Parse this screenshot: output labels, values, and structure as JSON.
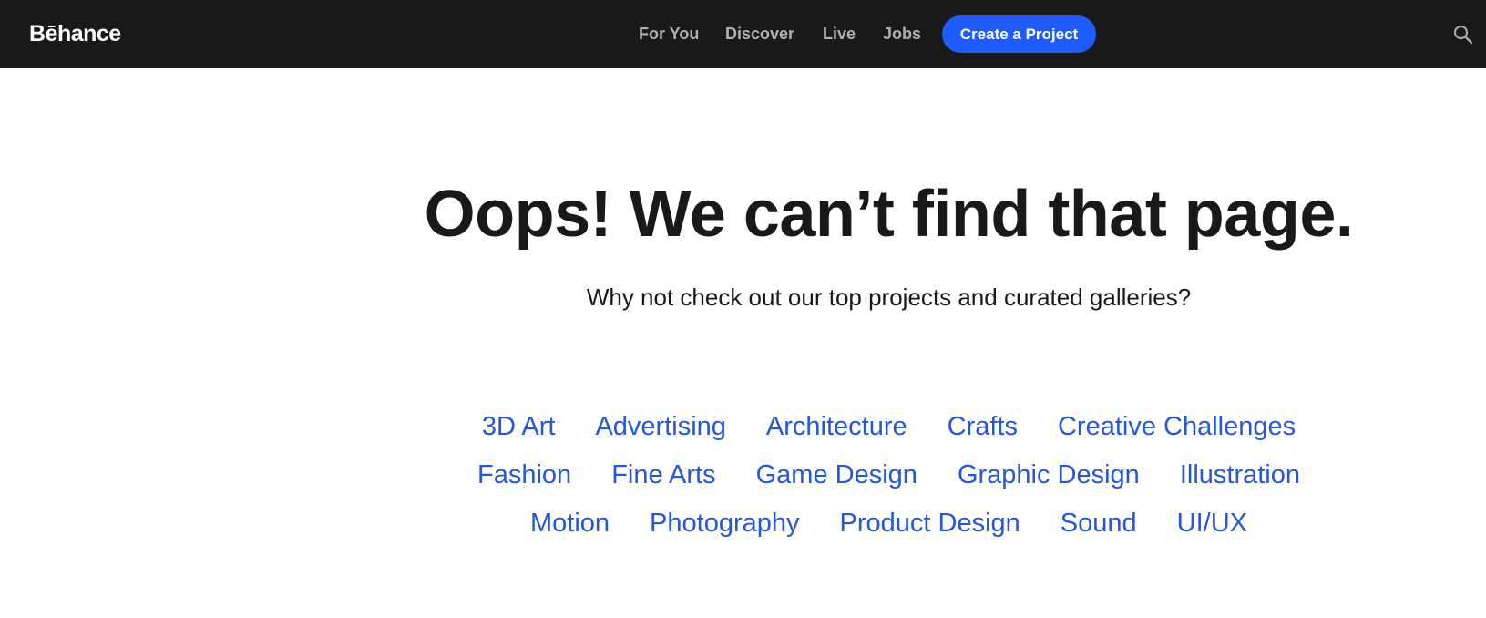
{
  "header": {
    "logo": "Bēhance",
    "nav": [
      "For You",
      "Discover",
      "Live",
      "Jobs"
    ],
    "cta_label": "Create a Project",
    "colors": {
      "bar": "#191919",
      "nav_text": "#b0b0b0",
      "cta_bg": "#1f5cff",
      "cta_text": "#ffffff"
    },
    "search_icon": "search-icon"
  },
  "main": {
    "headline": "Oops! We can’t find that page.",
    "subline": "Why not check out our top projects and curated galleries?",
    "link_color": "#2656d9",
    "category_rows": [
      [
        "3D Art",
        "Advertising",
        "Architecture",
        "Crafts",
        "Creative Challenges"
      ],
      [
        "Fashion",
        "Fine Arts",
        "Game Design",
        "Graphic Design",
        "Illustration"
      ],
      [
        "Motion",
        "Photography",
        "Product Design",
        "Sound",
        "UI/UX"
      ]
    ]
  }
}
